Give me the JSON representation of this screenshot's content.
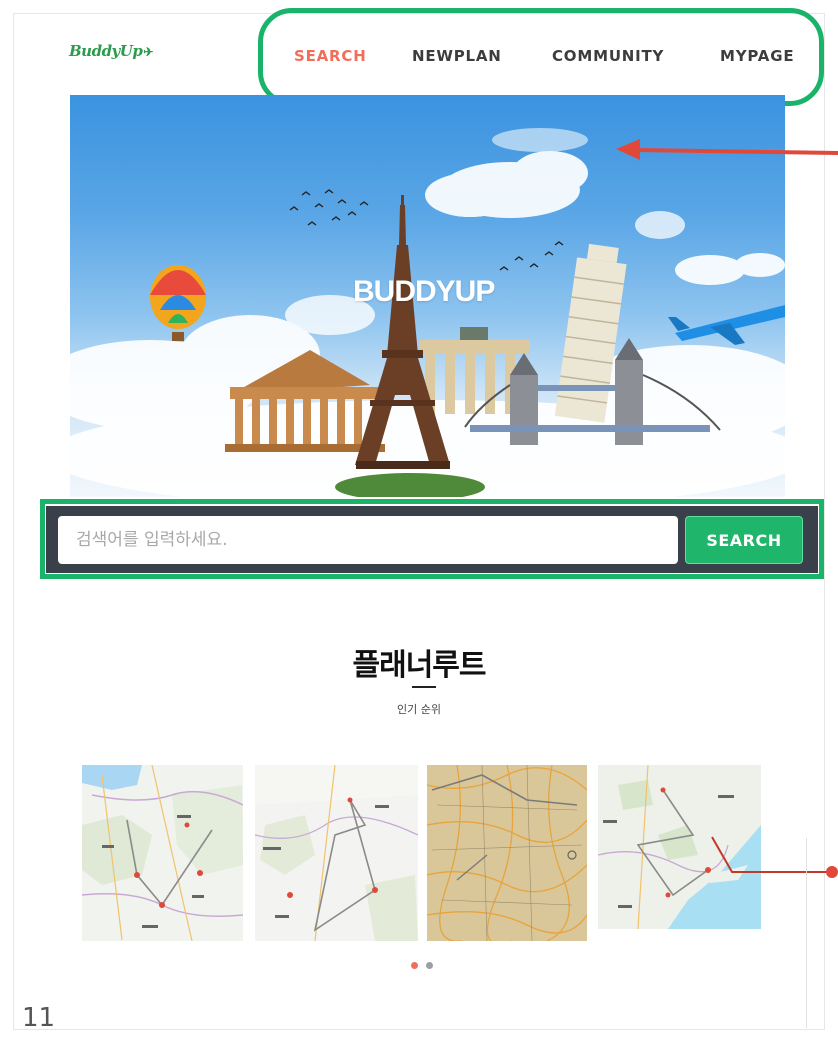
{
  "header": {
    "logo_text": "BuddyUp",
    "nav": {
      "search": "SEARCH",
      "newplan": "NEWPLAN",
      "community": "COMMUNITY",
      "mypage": "MYPAGE"
    },
    "active_nav": "SEARCH"
  },
  "hero": {
    "title": "BUDDYUP"
  },
  "search": {
    "placeholder": "검색어를 입력하세요.",
    "value": "",
    "button_label": "SEARCH"
  },
  "section": {
    "title": "플래너루트",
    "subtitle": "인기 순위"
  },
  "carousel": {
    "items": [
      {
        "icon": "route-map-poland"
      },
      {
        "icon": "route-map-pakistan"
      },
      {
        "icon": "route-map-road-atlas"
      },
      {
        "icon": "route-map-coastal"
      }
    ],
    "page_count": 2,
    "active_page": 1
  },
  "slide_number": "11",
  "colors": {
    "accent_green": "#19b369",
    "nav_active": "#f06e5a",
    "annotation_red": "#e0493a",
    "search_bar": "#3a4049"
  }
}
